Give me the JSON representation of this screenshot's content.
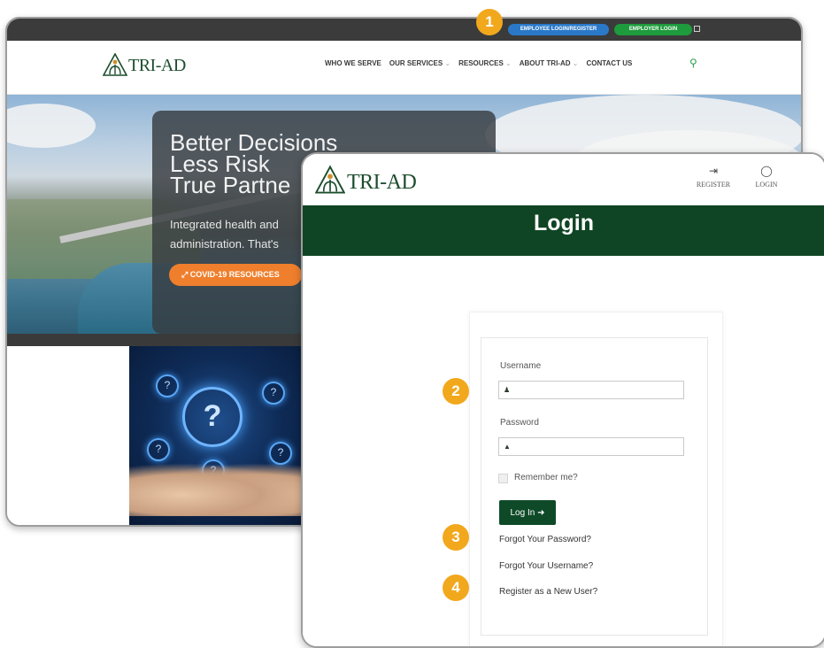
{
  "back_window": {
    "top_bar": {
      "employee_login_label": "EMPLOYEE LOGIN/REGISTER",
      "employer_login_label": "EMPLOYER LOGIN"
    },
    "logo_text": "TRI-AD",
    "nav": [
      {
        "label": "WHO WE SERVE",
        "has_caret": false
      },
      {
        "label": "OUR SERVICES",
        "has_caret": true
      },
      {
        "label": "RESOURCES",
        "has_caret": true
      },
      {
        "label": "ABOUT TRI-AD",
        "has_caret": true
      },
      {
        "label": "CONTACT US",
        "has_caret": false
      }
    ],
    "hero": {
      "title_lines": [
        "Better Decisions",
        "Less Risk",
        "True Partne"
      ],
      "subtitle": "Integrated health and administration. That's",
      "covid_button": "COVID-19 RESOURCES"
    }
  },
  "front_window": {
    "logo_text": "TRI-AD",
    "header_links": {
      "register": "REGISTER",
      "login": "LOGIN"
    },
    "banner_title": "Login",
    "form": {
      "username_label": "Username",
      "username_value": "",
      "password_label": "Password",
      "password_value": "",
      "remember_label": "Remember me?",
      "login_button": "Log In",
      "forgot_password": "Forgot Your Password?",
      "forgot_username": "Forgot Your Username?",
      "register_link": "Register as a New User?"
    }
  },
  "callouts": [
    "1",
    "2",
    "3",
    "4"
  ],
  "colors": {
    "brand_green": "#0f4524",
    "callout_orange": "#f2a81d",
    "employee_blue": "#2a79c9",
    "employer_green": "#1e9b3c",
    "covid_orange": "#ef7f2d"
  },
  "icons": {
    "search": "search-icon",
    "register": "sign-in-icon",
    "login": "user-circle-icon",
    "username": "user-icon",
    "password": "lock-icon",
    "submit": "arrow-circle-right-icon"
  }
}
